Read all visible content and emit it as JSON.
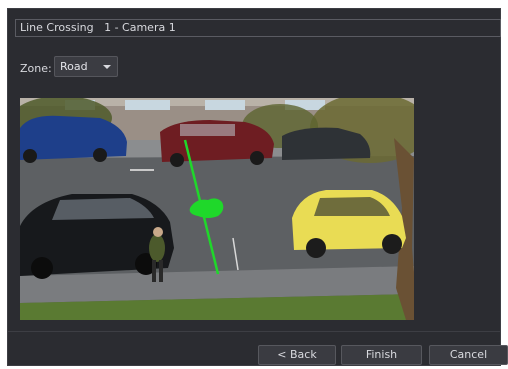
{
  "title": "Line Crossing   1 - Camera 1",
  "zone": {
    "label": "Zone:",
    "selected": "Road"
  },
  "buttons": {
    "back": "< Back",
    "finish": "Finish",
    "cancel": "Cancel"
  },
  "colors": {
    "dialog_bg": "#2b2c31",
    "line_color": "#1fd82a"
  }
}
